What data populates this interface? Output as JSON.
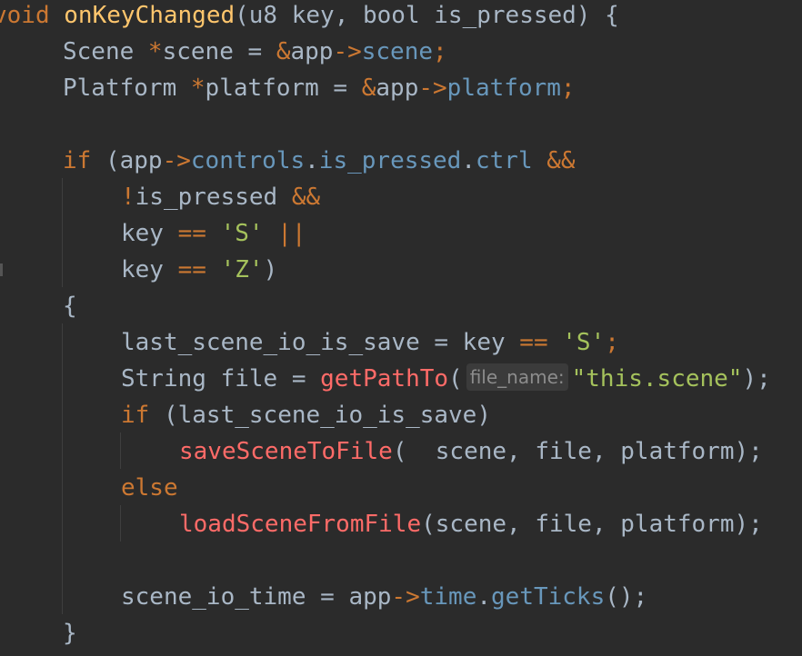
{
  "colors": {
    "background": "#2b2b2b",
    "keyword": "#cc7832",
    "function_decl": "#ffc66d",
    "function_call": "#ff6b68",
    "field": "#6897bb",
    "string": "#6a8759",
    "text": "#a9b7c6",
    "hint": "#8c8c8c"
  },
  "code": {
    "l1": {
      "kw": "void",
      "fn": "onKeyChanged",
      "p1": "(u8 key, bool is_pressed) {"
    },
    "l2": {
      "a": "Scene ",
      "b": "*",
      "c": "scene = ",
      "d": "&",
      "e": "app",
      "f": "->",
      "g": "scene",
      "h": ";"
    },
    "l3": {
      "a": "Platform ",
      "b": "*",
      "c": "platform = ",
      "d": "&",
      "e": "app",
      "f": "->",
      "g": "platform",
      "h": ";"
    },
    "l4": {
      "kw": "if",
      "a": " (app",
      "f": "->",
      "g": "controls",
      "d1": ".",
      "g2": "is_pressed",
      "d2": ".",
      "g3": "ctrl",
      "op": " &&"
    },
    "l5": {
      "op1": "!",
      "a": "is_pressed ",
      "op2": "&&"
    },
    "l6": {
      "a": "key ",
      "op1": "==",
      "s": " 'S'",
      "op2": " ||"
    },
    "l7": {
      "a": "key ",
      "op1": "==",
      "s": " 'Z'",
      "b": ")"
    },
    "l8": {
      "a": "{"
    },
    "l9": {
      "a": "last_scene_io_is_save = key ",
      "op": "==",
      "s": " 'S'",
      "b": ";"
    },
    "l10": {
      "a": "String file = ",
      "fn": "getPathTo",
      "b": "(",
      "hint": "file_name:",
      "s": "\"this.scene\"",
      "c": ");"
    },
    "l11": {
      "kw": "if",
      "a": " (last_scene_io_is_save)"
    },
    "l12": {
      "fn": "saveSceneToFile",
      "a": "(  scene, file, platform);"
    },
    "l13": {
      "kw": "else"
    },
    "l14": {
      "fn": "loadSceneFromFile",
      "a": "(scene, file, platform);"
    },
    "l15": {
      "a": "scene_io_time = app",
      "f": "->",
      "g": "time",
      "d": ".",
      "g2": "getTicks",
      "b": "();"
    },
    "l16": {
      "a": "}"
    }
  }
}
